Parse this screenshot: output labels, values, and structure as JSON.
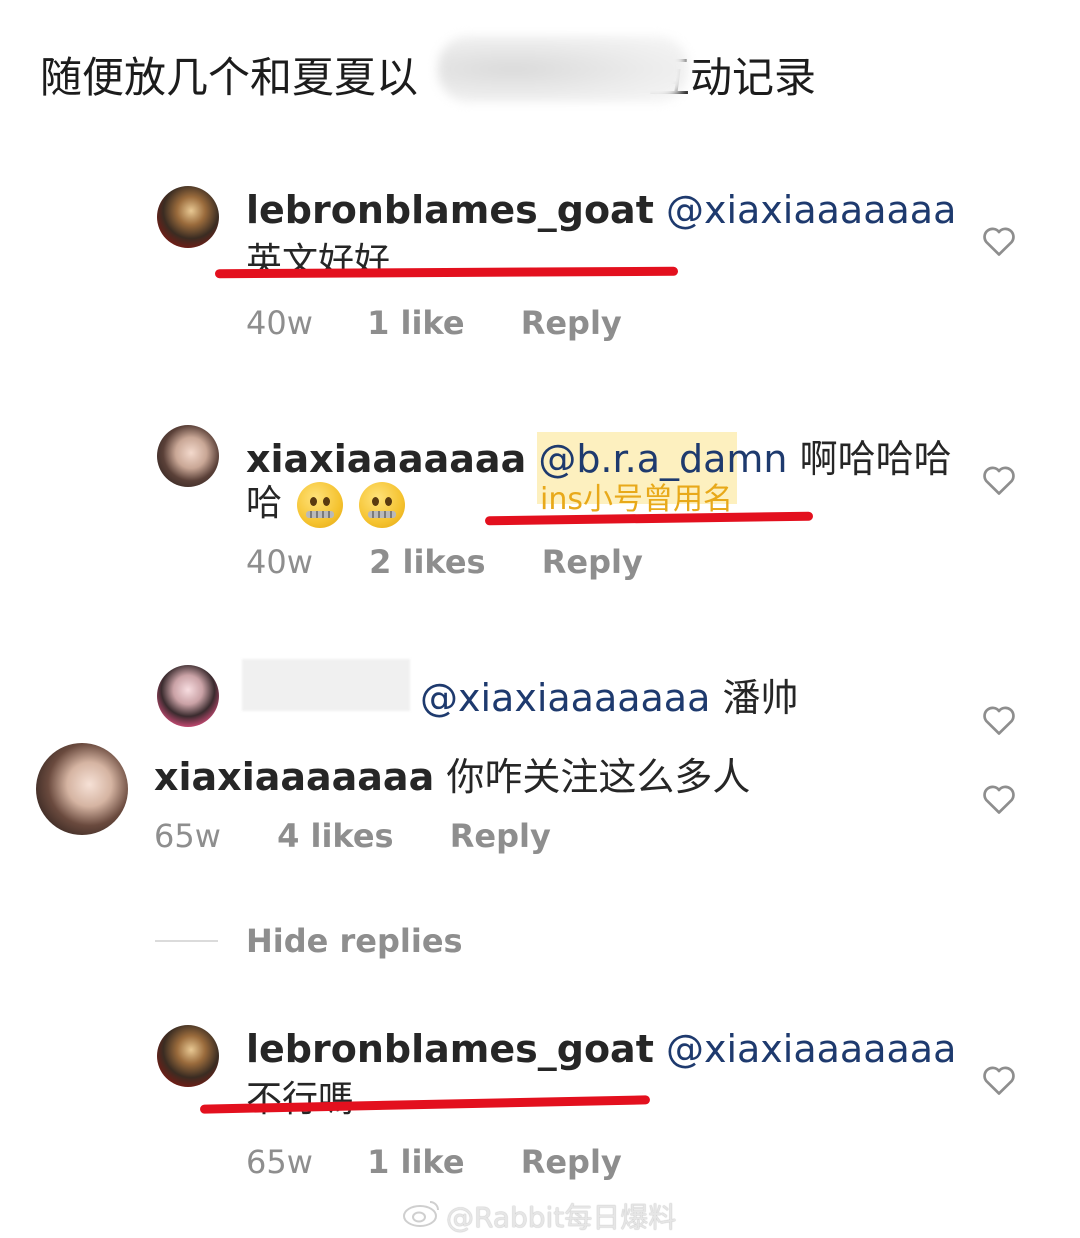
{
  "headline": {
    "start": "随便放几个和夏夏以",
    "end": "互动记录"
  },
  "comments": [
    {
      "username": "lebronblames_goat",
      "mention": "@xiaxiaaaaaaa",
      "text": "英文好好",
      "time": "40w",
      "likes": "1 like",
      "reply": "Reply"
    },
    {
      "username": "xiaxiaaaaaaa",
      "mention": "@b.r.a_damn",
      "text_line1": "啊哈哈哈",
      "text_line2": "哈",
      "annotation": "ins小号曾用名",
      "time": "40w",
      "likes": "2 likes",
      "reply": "Reply"
    },
    {
      "mention": "@xiaxiaaaaaaa",
      "text": "潘帅"
    },
    {
      "username": "xiaxiaaaaaaa",
      "text": "你咋关注这么多人",
      "time": "65w",
      "likes": "4 likes",
      "reply": "Reply"
    },
    {
      "username": "lebronblames_goat",
      "mention": "@xiaxiaaaaaaa",
      "text": "不行嗎",
      "time": "65w",
      "likes": "1 like",
      "reply": "Reply"
    }
  ],
  "hide_replies": "Hide replies",
  "watermark": "@Rabbit每日爆料",
  "icons": {
    "heart": "heart-outline-icon",
    "emoji": "zipper-mouth-face-emoji",
    "watermark_logo": "weibo-logo-icon"
  },
  "colors": {
    "mention": "#1e3a6e",
    "meta": "#8e8e8e",
    "underline": "#e3101e",
    "annotation": "#e8a91a"
  }
}
